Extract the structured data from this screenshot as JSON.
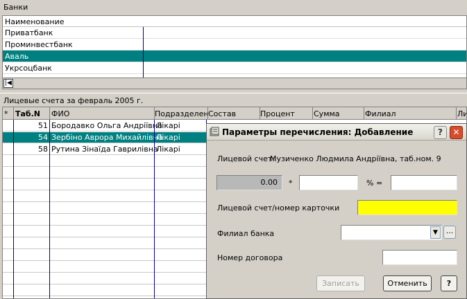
{
  "banks": {
    "caption": "Банки",
    "column_header": "Наименование",
    "rows": [
      "Приватбанк",
      "Проминвестбанк",
      "Аваль",
      "Укрсоцбанк"
    ],
    "selected_index": 2
  },
  "accounts": {
    "caption": "Лицевые счета за февраль 2005 г.",
    "columns": {
      "marker": "*",
      "tabn": "Таб.N",
      "fio": "ФИО",
      "division": "Подразделени",
      "sostav": "Состав",
      "percent": "Процент",
      "sum": "Сумма",
      "filial": "Филиал",
      "extra": "Ли"
    },
    "rows": [
      {
        "tabn": "51",
        "fio": "Бородавко Ольга Андріївна",
        "division": "Лікарі"
      },
      {
        "tabn": "54",
        "fio": "Зербіно Аврора Михайлівна",
        "division": "Лікарі"
      },
      {
        "tabn": "58",
        "fio": "Рутина Зінаїда Гаврилівна",
        "division": "Лікарі"
      }
    ],
    "selected_index": 1
  },
  "dialog": {
    "title": "Параметры перечисления: Добавление",
    "account_label": "Лицевой счет:",
    "account_value": "Музиченко Людмила Андріївна, таб.ном. 9",
    "amount_value": "0.00",
    "multiply_sign": "*",
    "percent_sign": "% =",
    "card_label": "Лицевой счет/номер карточки",
    "branch_label": "Филиал банка",
    "contract_label": "Номер договора",
    "save_label": "Записать",
    "cancel_label": "Отменить",
    "help_label": "?",
    "help_title_label": "?",
    "close_label": "✕",
    "first_label": "|◀",
    "combo_arrow": "▼",
    "ellipsis_label": "...",
    "colors": {
      "selection": "#008080",
      "card_field": "#ffff00",
      "close_button": "#d54d2c"
    }
  }
}
